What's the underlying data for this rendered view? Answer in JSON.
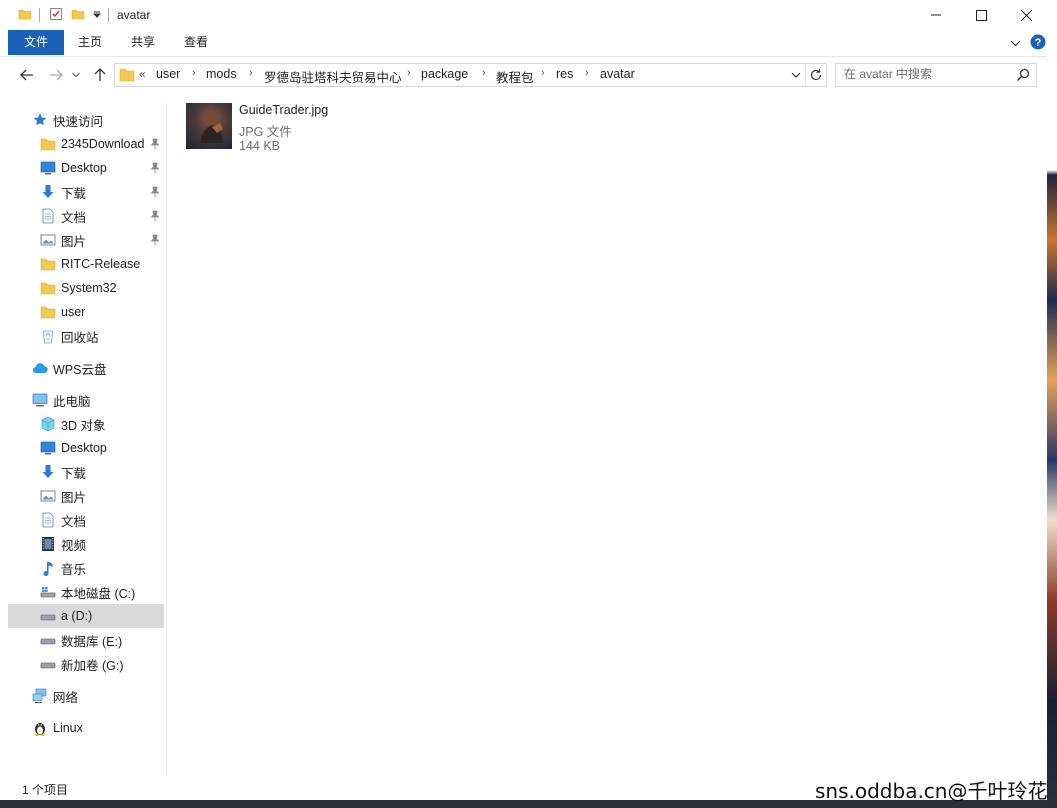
{
  "window": {
    "title": "avatar"
  },
  "ribbon": {
    "tabs": [
      "文件",
      "主页",
      "共享",
      "查看"
    ]
  },
  "address": {
    "overflow": "«",
    "crumbs": [
      "user",
      "mods",
      "罗德岛驻塔科夫贸易中心",
      "package",
      "教程包",
      "res",
      "avatar"
    ]
  },
  "search": {
    "placeholder": "在 avatar 中搜索"
  },
  "nav": {
    "quick_access": "快速访问",
    "qa_items": [
      "2345Download",
      "Desktop",
      "下载",
      "文档",
      "图片",
      "RITC-Release",
      "System32",
      "user",
      "回收站"
    ],
    "wps": "WPS云盘",
    "this_pc": "此电脑",
    "pc_items": [
      "3D 对象",
      "Desktop",
      "下载",
      "图片",
      "文档",
      "视频",
      "音乐",
      "本地磁盘 (C:)",
      "a (D:)",
      "数据库 (E:)",
      "新加卷 (G:)"
    ],
    "network": "网络",
    "linux": "Linux"
  },
  "files": [
    {
      "name": "GuideTrader.jpg",
      "type": "JPG 文件",
      "size": "144 KB"
    }
  ],
  "status": {
    "count": "1 个项目"
  },
  "watermark": "sns.oddba.cn@千叶玲花",
  "colors": {
    "accent": "#1a62b8",
    "selected": "#d9d9d9",
    "folder": "#f3c94f"
  }
}
